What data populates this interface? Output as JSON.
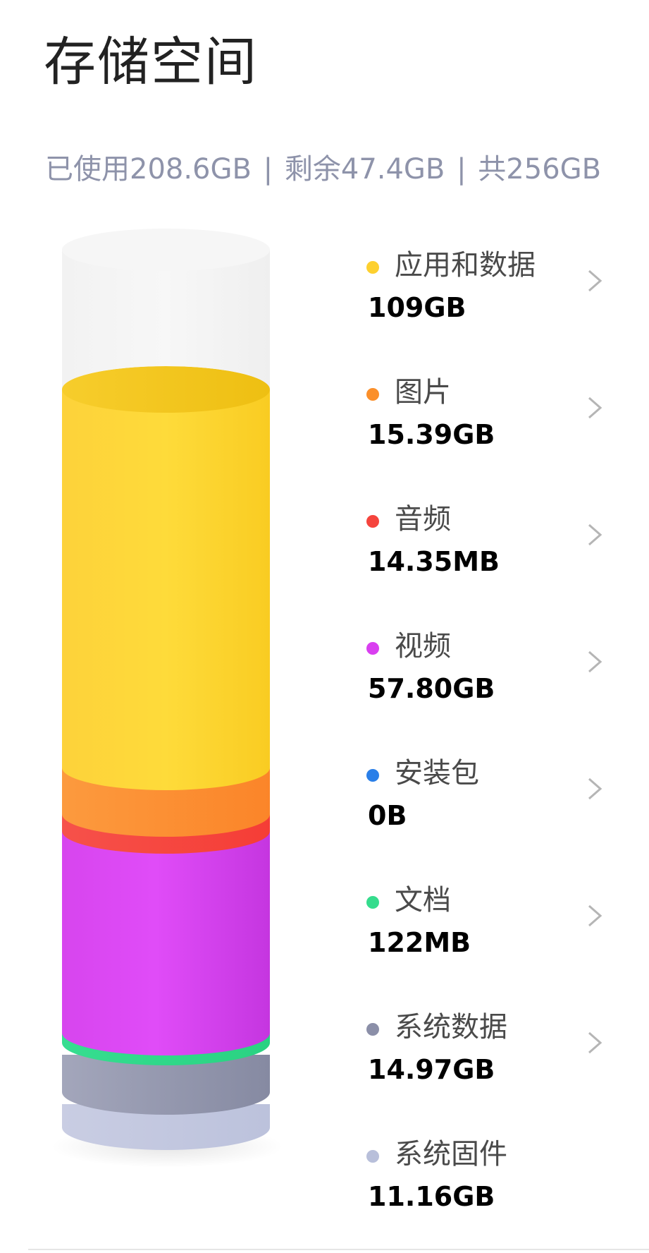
{
  "page": {
    "title": "存储空间"
  },
  "summary": {
    "used": "已使用208.6GB",
    "remaining": "剩余47.4GB",
    "total": "共256GB",
    "separator": "|"
  },
  "categories": [
    {
      "name": "应用和数据",
      "size": "109GB",
      "color": "#fdd02f",
      "clickable": true
    },
    {
      "name": "图片",
      "size": "15.39GB",
      "color": "#fb8f2a",
      "clickable": true
    },
    {
      "name": "音频",
      "size": "14.35MB",
      "color": "#f5443d",
      "clickable": true
    },
    {
      "name": "视频",
      "size": "57.80GB",
      "color": "#d93ff0",
      "clickable": true
    },
    {
      "name": "安装包",
      "size": "0B",
      "color": "#2a7fe8",
      "clickable": true
    },
    {
      "name": "文档",
      "size": "122MB",
      "color": "#35dc8d",
      "clickable": true
    },
    {
      "name": "系统数据",
      "size": "14.97GB",
      "color": "#8b8fa8",
      "clickable": true
    },
    {
      "name": "系统固件",
      "size": "11.16GB",
      "color": "#b8bfda",
      "clickable": false
    }
  ],
  "storage_chart": {
    "total_gb": 256,
    "free_gb": 47.4,
    "segment_order_bottom_to_top": [
      "系统固件",
      "系统数据",
      "文档",
      "视频",
      "音频",
      "图片",
      "应用和数据"
    ],
    "free_color": "#f4f4f4"
  },
  "icons": {
    "chevron": "chevron-right-icon"
  }
}
